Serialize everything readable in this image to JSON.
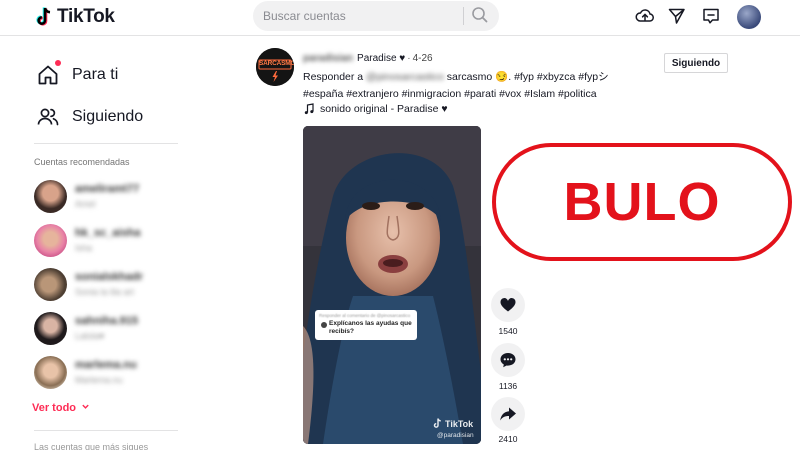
{
  "header": {
    "logo_text": "TikTok",
    "search_placeholder": "Buscar cuentas",
    "icons": [
      "upload-icon",
      "send-icon",
      "inbox-icon",
      "profile-avatar"
    ]
  },
  "sidebar": {
    "nav": [
      {
        "label": "Para ti",
        "icon": "home-icon"
      },
      {
        "label": "Siguiendo",
        "icon": "users-icon"
      }
    ],
    "recommended_heading": "Cuentas recomendadas",
    "accounts": [
      {
        "name": "ameliramt77",
        "sub": "Amel"
      },
      {
        "name": "hk_sc_aisha",
        "sub": "Isha"
      },
      {
        "name": "sonialskhadr",
        "sub": "Sonia la lila art"
      },
      {
        "name": "sahniha.915",
        "sub": "Lalola♥"
      },
      {
        "name": "marlema.nu",
        "sub": "Marlema.nu"
      }
    ],
    "see_all": "Ver todo",
    "footer_text": "Las cuentas que más sigues"
  },
  "post": {
    "avatar_label": "SARCASMO",
    "username": "paradisian",
    "display_name": "Paradise ♥",
    "separator": "·",
    "date": "4-26",
    "caption_prefix": "Responder a",
    "reply_to": "@pinosarcastico",
    "caption_rest": "sarcasmo 😏. #fyp #xbyzca #fypシ #españa #extranjero #inmigracion #parati #vox #Islam #politica",
    "sound": "sonido original - Paradise ♥",
    "follow_label": "Siguiendo",
    "video": {
      "reply_small": "Responder al comentario de @pinosarcastico",
      "reply_text": "Explícanos las ayudas que recibís?",
      "watermark": "TikTok",
      "watermark_user": "@paradisian"
    },
    "actions": {
      "likes": "1540",
      "comments": "1136",
      "shares": "2410"
    }
  },
  "overlay": {
    "stamp_text": "BULO",
    "stamp_color": "#e3121b"
  },
  "colors": {
    "accent": "#fe2c55",
    "text": "#161823"
  }
}
